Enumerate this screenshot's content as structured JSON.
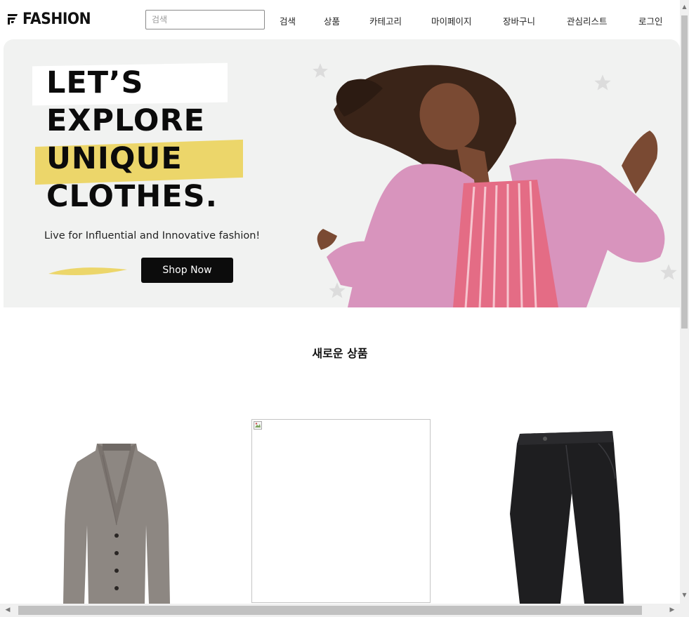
{
  "header": {
    "logo_text": "FASHION",
    "search": {
      "placeholder": "검색",
      "value": ""
    },
    "nav": [
      {
        "label": "검색"
      },
      {
        "label": "상품"
      },
      {
        "label": "카테고리"
      },
      {
        "label": "마이페이지"
      },
      {
        "label": "장바구니"
      },
      {
        "label": "관심리스트"
      },
      {
        "label": "로그인"
      }
    ]
  },
  "hero": {
    "headline": [
      "LET’S",
      "EXPLORE",
      "UNIQUE",
      "CLOTHES."
    ],
    "tagline": "Live for Influential and Innovative fashion!",
    "cta_label": "Shop Now",
    "colors": {
      "highlight": "#ecd66a",
      "background": "#f1f2f1",
      "button": "#0c0c0c"
    }
  },
  "new_products": {
    "title": "새로운 상품",
    "items": [
      {
        "image": "gray-cardigan"
      },
      {
        "image": "broken-image"
      },
      {
        "image": "black-pants"
      }
    ]
  },
  "scrollbars": {
    "vertical": "vertical-scrollbar",
    "horizontal": "horizontal-scrollbar"
  }
}
